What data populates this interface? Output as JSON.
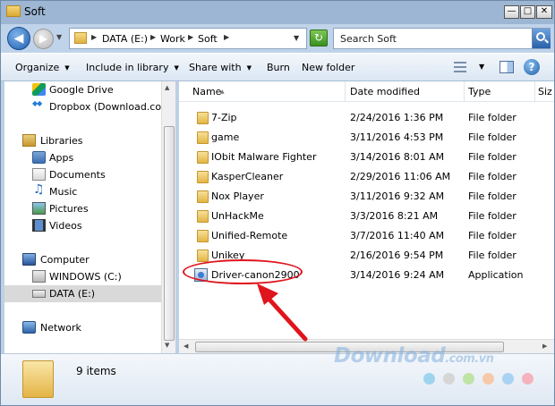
{
  "window": {
    "title": "Soft"
  },
  "controls": {
    "minimize": "—",
    "maximize": "□",
    "close": "✕"
  },
  "address": {
    "crumbs": [
      "DATA (E:)",
      "Work",
      "Soft"
    ],
    "search_placeholder": "Search Soft"
  },
  "toolbar": {
    "organize": "Organize",
    "include_in_library": "Include in library",
    "share_with": "Share with",
    "burn": "Burn",
    "new_folder": "New folder"
  },
  "nav": {
    "items": [
      {
        "label": "Google Drive",
        "icon": "google-drive-icon"
      },
      {
        "label": "Dropbox (Download.com.v",
        "icon": "dropbox-icon"
      },
      {
        "label": "Libraries",
        "icon": "libraries-icon"
      },
      {
        "label": "Apps",
        "icon": "apps-icon"
      },
      {
        "label": "Documents",
        "icon": "documents-icon"
      },
      {
        "label": "Music",
        "icon": "music-icon"
      },
      {
        "label": "Pictures",
        "icon": "pictures-icon"
      },
      {
        "label": "Videos",
        "icon": "videos-icon"
      },
      {
        "label": "Computer",
        "icon": "computer-icon"
      },
      {
        "label": "WINDOWS (C:)",
        "icon": "windows-drive-icon"
      },
      {
        "label": "DATA (E:)",
        "icon": "drive-icon"
      },
      {
        "label": "Network",
        "icon": "network-icon"
      }
    ],
    "selected": "DATA (E:)"
  },
  "columns": {
    "name": "Name",
    "date": "Date modified",
    "type": "Type",
    "size": "Siz"
  },
  "files": [
    {
      "name": "7-Zip",
      "date": "2/24/2016 1:36 PM",
      "type": "File folder",
      "kind": "folder"
    },
    {
      "name": "game",
      "date": "3/11/2016 4:53 PM",
      "type": "File folder",
      "kind": "folder"
    },
    {
      "name": "IObit Malware Fighter",
      "date": "3/14/2016 8:01 AM",
      "type": "File folder",
      "kind": "folder"
    },
    {
      "name": "KasperCleaner",
      "date": "2/29/2016 11:06 AM",
      "type": "File folder",
      "kind": "folder"
    },
    {
      "name": "Nox Player",
      "date": "3/11/2016 9:32 AM",
      "type": "File folder",
      "kind": "folder"
    },
    {
      "name": "UnHackMe",
      "date": "3/3/2016 8:21 AM",
      "type": "File folder",
      "kind": "folder"
    },
    {
      "name": "Unified-Remote",
      "date": "3/7/2016 11:40 AM",
      "type": "File folder",
      "kind": "folder"
    },
    {
      "name": "Unikey",
      "date": "2/16/2016 9:54 PM",
      "type": "File folder",
      "kind": "folder"
    },
    {
      "name": "Driver-canon2900",
      "date": "3/14/2016 9:24 AM",
      "type": "Application",
      "kind": "application"
    }
  ],
  "status": {
    "items_count": "9 items"
  },
  "watermark": {
    "text": "Download",
    "suffix": ".com.vn"
  },
  "colors": {
    "annotation": "#e0141c",
    "accent": "#1f5fa8"
  }
}
